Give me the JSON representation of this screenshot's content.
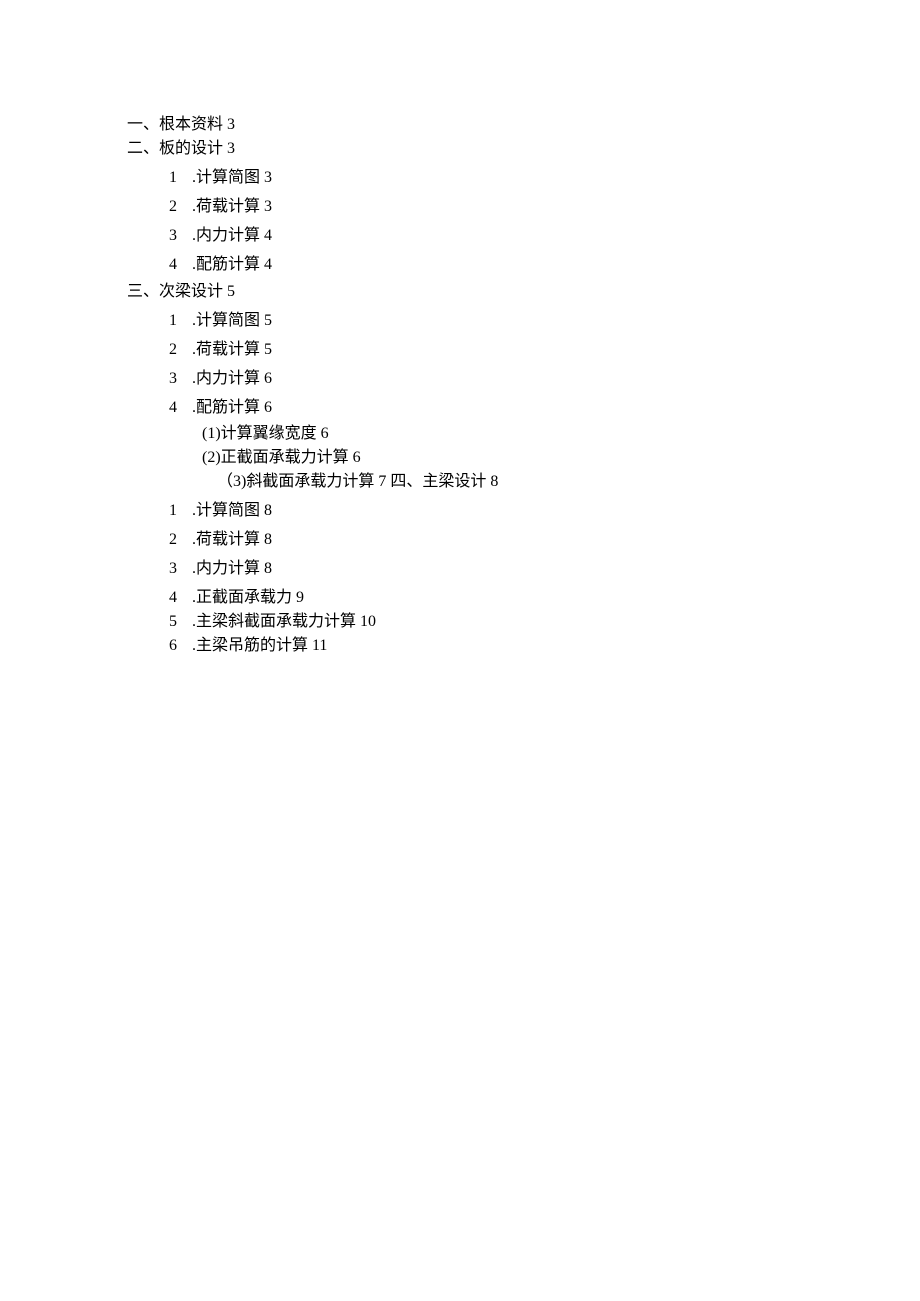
{
  "toc": {
    "s1": {
      "title": "一、根本资料",
      "page": "3"
    },
    "s2": {
      "title": "二、板的设计",
      "page": "3",
      "i1": {
        "n": "1",
        "t": ".计算简图",
        "p": "3"
      },
      "i2": {
        "n": "2",
        "t": ".荷载计算",
        "p": "3"
      },
      "i3": {
        "n": "3",
        "t": ".内力计算",
        "p": "4"
      },
      "i4": {
        "n": "4",
        "t": ".配筋计算",
        "p": "4"
      }
    },
    "s3": {
      "title": "三、次梁设计",
      "page": "5",
      "i1": {
        "n": "1",
        "t": ".计算简图",
        "p": "5"
      },
      "i2": {
        "n": "2",
        "t": ".荷载计算",
        "p": "5"
      },
      "i3": {
        "n": "3",
        "t": ".内力计算",
        "p": "6"
      },
      "i4": {
        "n": "4",
        "t": ".配筋计算",
        "p": "6"
      },
      "sub": {
        "a": "(1)计算翼缘宽度 6",
        "b": "(2)正截面承载力计算 6",
        "c": "（3)斜截面承载力计算 7 四、主梁设计 8"
      }
    },
    "s4": {
      "i1": {
        "n": "1",
        "t": ".计算简图",
        "p": "8"
      },
      "i2": {
        "n": "2",
        "t": ".荷载计算",
        "p": "8"
      },
      "i3": {
        "n": "3",
        "t": ".内力计算",
        "p": "8"
      },
      "i4": {
        "n": "4",
        "t": ".正截面承载力",
        "p": "9"
      },
      "i5": {
        "n": "5",
        "t": ".主梁斜截面承载力计算",
        "p": "10"
      },
      "i6": {
        "n": "6",
        "t": ".主梁吊筋的计算",
        "p": "11"
      }
    }
  }
}
